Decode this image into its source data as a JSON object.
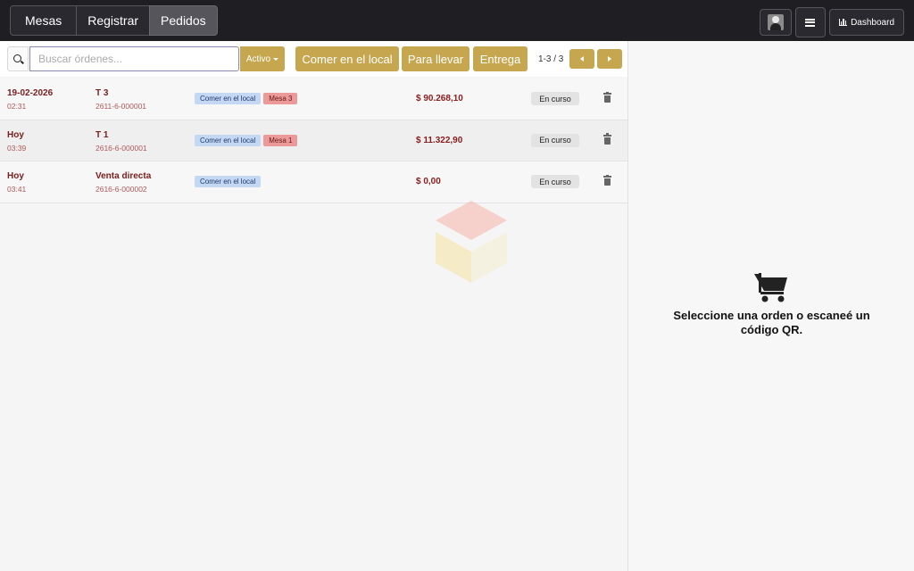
{
  "nav": {
    "tabs": [
      {
        "label": "Mesas",
        "active": false
      },
      {
        "label": "Registrar",
        "active": false
      },
      {
        "label": "Pedidos",
        "active": true
      }
    ],
    "dashboard_label": "Dashboard"
  },
  "toolbar": {
    "search_placeholder": "Buscar órdenes...",
    "search_value": "",
    "status_filter": "Activo",
    "filters": [
      "Comer en el local",
      "Para llevar",
      "Entrega"
    ],
    "pagination": "1-3 / 3"
  },
  "orders": [
    {
      "date": "19-02-2026",
      "time": "02:31",
      "name": "T 3",
      "code": "2611-6-000001",
      "service": "Comer en el local",
      "table": "Mesa 3",
      "total": "$ 90.268,10",
      "status": "En curso"
    },
    {
      "date": "Hoy",
      "time": "03:39",
      "name": "T 1",
      "code": "2616-6-000001",
      "service": "Comer en el local",
      "table": "Mesa 1",
      "total": "$ 11.322,90",
      "status": "En curso"
    },
    {
      "date": "Hoy",
      "time": "03:41",
      "name": "Venta directa",
      "code": "2616-6-000002",
      "service": "Comer en el local",
      "table": null,
      "total": "$ 0,00",
      "status": "En curso"
    }
  ],
  "detail": {
    "empty_line1": "Seleccione una orden o escaneé un",
    "empty_line2": "código QR."
  },
  "colors": {
    "topbar": "#1f1e23",
    "accent_gold": "#c6a64f",
    "text_dark_red": "#7a1d1d",
    "badge_blue": "#c4d8f4",
    "badge_red": "#eb9999"
  }
}
